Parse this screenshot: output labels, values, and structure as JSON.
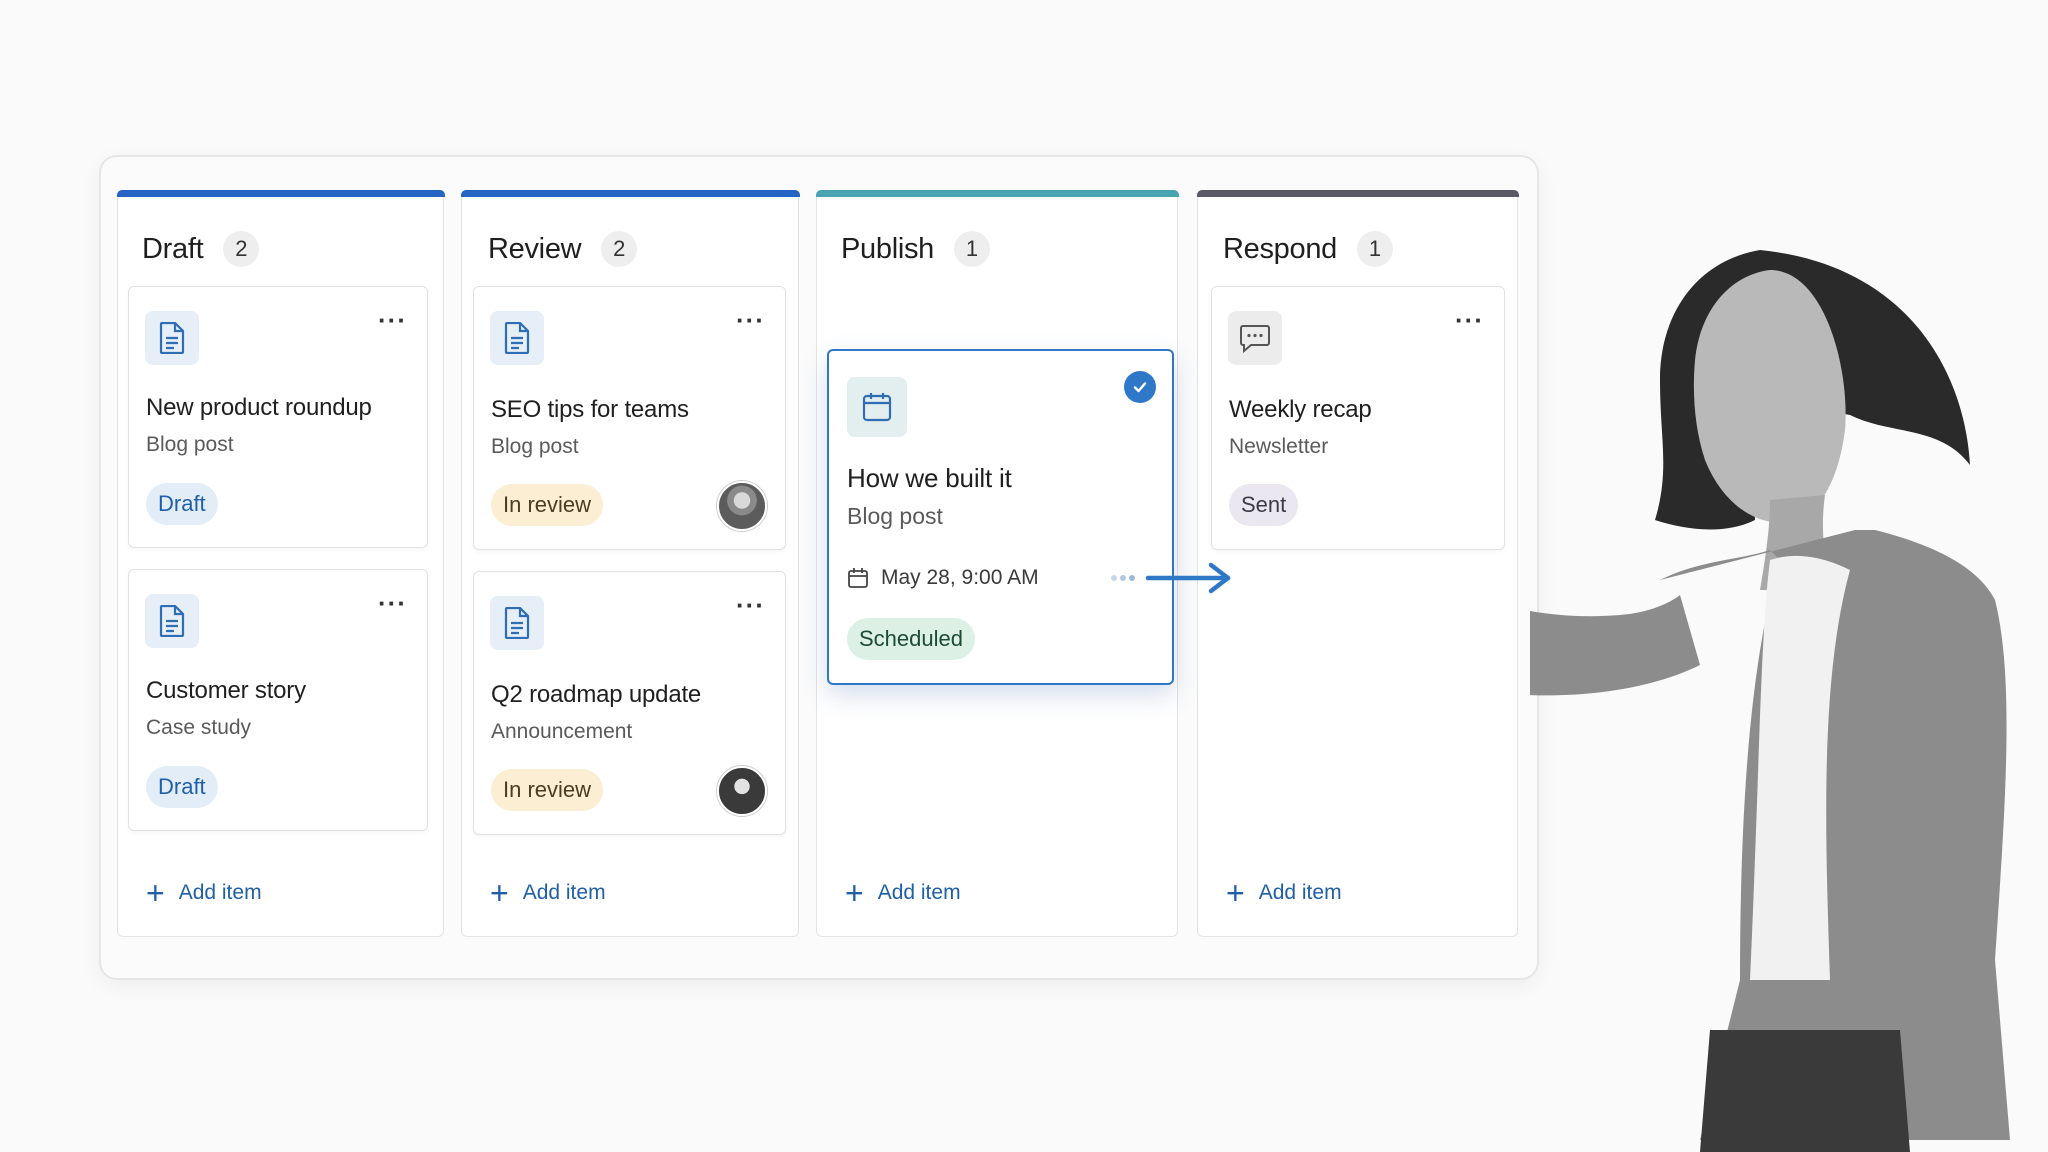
{
  "board": {
    "add_label": "Add item",
    "columns": [
      {
        "title": "Draft",
        "count": "2",
        "accent": "#2563c4",
        "cards": [
          {
            "title": "New product roundup",
            "type": "Blog post",
            "status": "Draft",
            "icon": "document-icon"
          },
          {
            "title": "Customer story",
            "type": "Case study",
            "status": "Draft",
            "icon": "document-icon"
          }
        ]
      },
      {
        "title": "Review",
        "count": "2",
        "accent": "#2563c4",
        "cards": [
          {
            "title": "SEO tips for teams",
            "type": "Blog post",
            "status": "In review",
            "icon": "document-icon"
          },
          {
            "title": "Q2 roadmap update",
            "type": "Announcement",
            "status": "In review",
            "icon": "document-icon"
          }
        ]
      },
      {
        "title": "Publish",
        "count": "1",
        "accent": "#4aa3b0",
        "cards": [
          {
            "title": "How we built it",
            "type": "Blog post",
            "date": "May 28, 9:00 AM",
            "status": "Scheduled",
            "icon": "calendar-icon"
          }
        ]
      },
      {
        "title": "Respond",
        "count": "1",
        "accent": "#5b5866",
        "cards": [
          {
            "title": "Weekly recap",
            "type": "Newsletter",
            "status": "Sent",
            "icon": "chat-icon"
          }
        ]
      }
    ]
  },
  "colors": {
    "primary": "#2f78c8",
    "draft_pill": "#e3edf8",
    "review_pill": "#fbeed2",
    "scheduled_pill": "#dcf0e6",
    "sent_pill": "#ebe7f1"
  }
}
